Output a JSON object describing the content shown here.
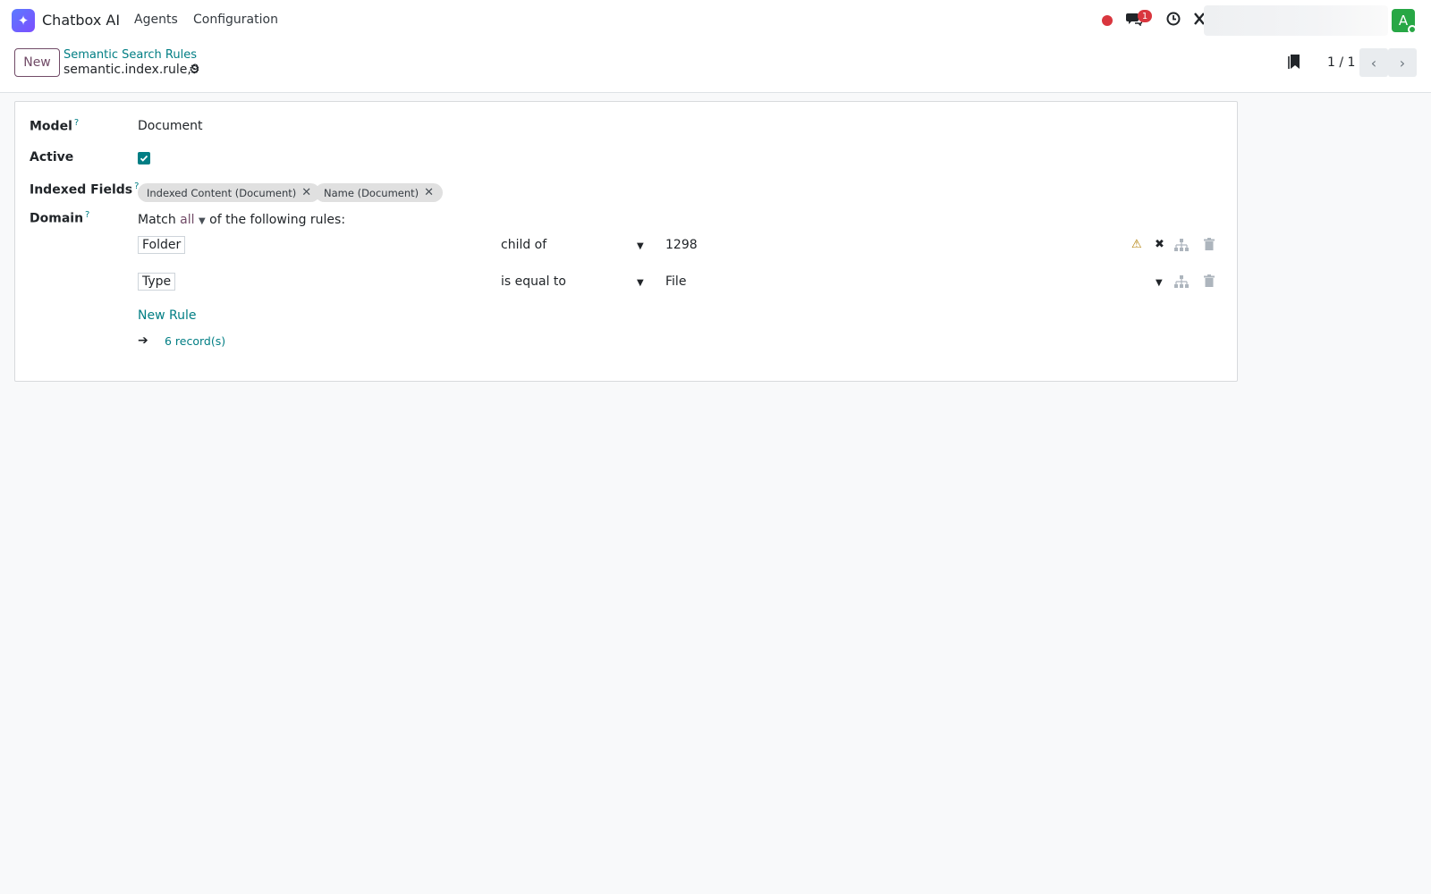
{
  "navbar": {
    "app_icon": "sparkle-icon",
    "app_name": "Chatbox AI",
    "menus": [
      "Agents",
      "Configuration"
    ],
    "chat_badge": "1",
    "avatar_letter": "A"
  },
  "control_panel": {
    "new_label": "New",
    "breadcrumb_parent": "Semantic Search Rules",
    "breadcrumb_current": "semantic.index.rule,9",
    "pager_value": "1 / 1"
  },
  "form": {
    "model_label": "Model",
    "model_value": "Document",
    "active_label": "Active",
    "active_checked": true,
    "indexed_fields_label": "Indexed Fields",
    "indexed_fields": [
      "Indexed Content (Document)",
      "Name (Document)"
    ],
    "domain_label": "Domain",
    "domain": {
      "prefix": "Match",
      "connector": "all",
      "suffix": "of the following rules:",
      "rules": [
        {
          "path": "Folder",
          "operator": "child of",
          "value": "1298"
        },
        {
          "path": "Type",
          "operator": "is equal to",
          "value": "File"
        }
      ],
      "new_rule_label": "New Rule",
      "records_label": "6 record(s)"
    }
  },
  "colors": {
    "brand": "#714b67",
    "link": "#017e84",
    "warning": "#b07c00",
    "badge": "#d9363e",
    "avatar": "#27a745"
  }
}
